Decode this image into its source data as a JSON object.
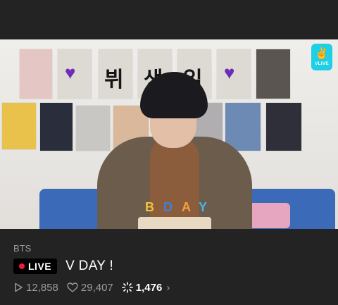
{
  "video": {
    "wall_hangul": [
      "뷔",
      "생",
      "일"
    ],
    "cake_letters": [
      "B",
      "D",
      "A",
      "Y"
    ],
    "watermark": {
      "icon": "vlive-logo-icon",
      "label": "VLIVE"
    }
  },
  "channel": {
    "name": "BTS"
  },
  "stream": {
    "status": "LIVE",
    "title": "V DAY !"
  },
  "stats": {
    "plays": "12,858",
    "likes": "29,407",
    "hot": "1,476"
  },
  "icons": {
    "play": "play-icon",
    "like": "heart-icon",
    "hot": "burst-icon",
    "more": "chevron-right-icon"
  },
  "colors": {
    "background": "#232323",
    "live_dot": "#f0183c",
    "vlive": "#1ecfe5",
    "muted_text": "#9a9a9a"
  }
}
